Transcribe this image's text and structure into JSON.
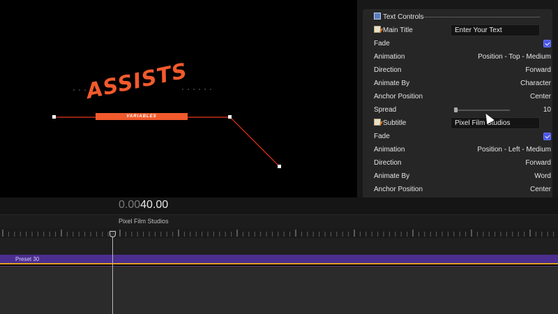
{
  "viewer": {
    "title_main": "ASSISTS",
    "title_sub": "VARIABLES",
    "accent_color": "#f25a2c"
  },
  "inspector": {
    "section_title": "Text Controls",
    "main_title": {
      "label": "Main Title",
      "value": "Enter Your Text",
      "fade_label": "Fade",
      "fade_checked": true,
      "animation_label": "Animation",
      "animation_value": "Position - Top - Medium",
      "direction_label": "Direction",
      "direction_value": "Forward",
      "animate_by_label": "Animate By",
      "animate_by_value": "Character",
      "anchor_label": "Anchor Position",
      "anchor_value": "Center",
      "spread_label": "Spread",
      "spread_value": "10"
    },
    "subtitle": {
      "label": "Subtitle",
      "value": "Pixel Film Studios",
      "fade_label": "Fade",
      "fade_checked": true,
      "animation_label": "Animation",
      "animation_value": "Position - Left - Medium",
      "direction_label": "Direction",
      "direction_value": "Forward",
      "animate_by_label": "Animate By",
      "animate_by_value": "Word",
      "anchor_label": "Anchor Position",
      "anchor_value": "Center"
    },
    "checkbox_color": "#4a55e8"
  },
  "timeline": {
    "timecode_dim": "0.00",
    "timecode_main": "40.00",
    "project_name": "Pixel Film Studios",
    "clip_label": "Preset 30",
    "clip_color": "#4b2d8f",
    "clip_border_color": "#e0a020"
  }
}
